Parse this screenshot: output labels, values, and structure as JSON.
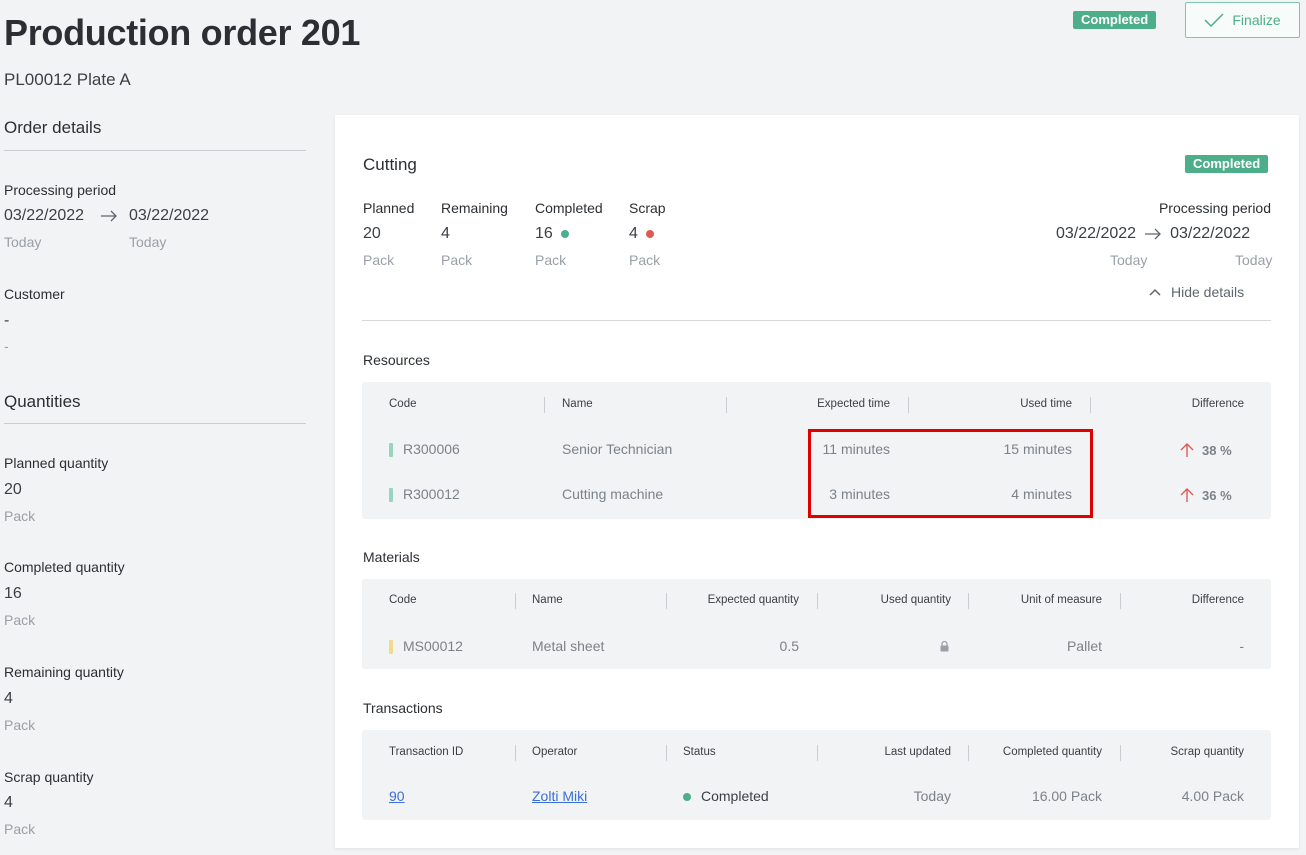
{
  "header": {
    "title": "Production order 201",
    "subtitle": "PL00012 Plate A",
    "status": "Completed",
    "finalize_label": "Finalize"
  },
  "order_details": {
    "title": "Order details",
    "processing_period_label": "Processing period",
    "start_date": "03/22/2022",
    "end_date": "03/22/2022",
    "start_sub": "Today",
    "end_sub": "Today",
    "customer_label": "Customer",
    "customer_value": "-",
    "customer_sub": "-"
  },
  "quantities": {
    "title": "Quantities",
    "planned_label": "Planned quantity",
    "planned_value": "20",
    "planned_unit": "Pack",
    "completed_label": "Completed quantity",
    "completed_value": "16",
    "completed_unit": "Pack",
    "remaining_label": "Remaining quantity",
    "remaining_value": "4",
    "remaining_unit": "Pack",
    "scrap_label": "Scrap quantity",
    "scrap_value": "4",
    "scrap_unit": "Pack"
  },
  "operation": {
    "title": "Cutting",
    "status": "Completed",
    "stats": {
      "planned_label": "Planned",
      "planned_value": "20",
      "planned_unit": "Pack",
      "remaining_label": "Remaining",
      "remaining_value": "4",
      "remaining_unit": "Pack",
      "completed_label": "Completed",
      "completed_value": "16",
      "completed_unit": "Pack",
      "scrap_label": "Scrap",
      "scrap_value": "4",
      "scrap_unit": "Pack"
    },
    "processing_period_label": "Processing period",
    "start_date": "03/22/2022",
    "end_date": "03/22/2022",
    "start_sub": "Today",
    "end_sub": "Today",
    "hide_details_label": "Hide details",
    "colors": {
      "completed_dot": "#4caf8a",
      "scrap_dot": "#e05a55",
      "status": "#4caf8a",
      "up_arrow": "#e05a55"
    }
  },
  "resources": {
    "title": "Resources",
    "columns": [
      "Code",
      "Name",
      "Expected time",
      "Used time",
      "Difference"
    ],
    "rows": [
      {
        "code": "R300006",
        "name": "Senior Technician",
        "expected": "11 minutes",
        "used": "15 minutes",
        "difference": "38 %"
      },
      {
        "code": "R300012",
        "name": "Cutting machine",
        "expected": "3 minutes",
        "used": "4 minutes",
        "difference": "36 %"
      }
    ]
  },
  "materials": {
    "title": "Materials",
    "columns": [
      "Code",
      "Name",
      "Expected quantity",
      "Used quantity",
      "Unit of measure",
      "Difference"
    ],
    "rows": [
      {
        "code": "MS00012",
        "name": "Metal sheet",
        "expected": "0.5",
        "used_icon": "lock-icon",
        "unit": "Pallet",
        "difference": "-"
      }
    ]
  },
  "transactions": {
    "title": "Transactions",
    "columns": [
      "Transaction ID",
      "Operator",
      "Status",
      "Last updated",
      "Completed quantity",
      "Scrap quantity"
    ],
    "rows": [
      {
        "id": "90",
        "operator": "Zolti Miki",
        "status": "Completed",
        "last_updated": "Today",
        "completed": "16.00 Pack",
        "scrap": "4.00 Pack"
      }
    ]
  }
}
